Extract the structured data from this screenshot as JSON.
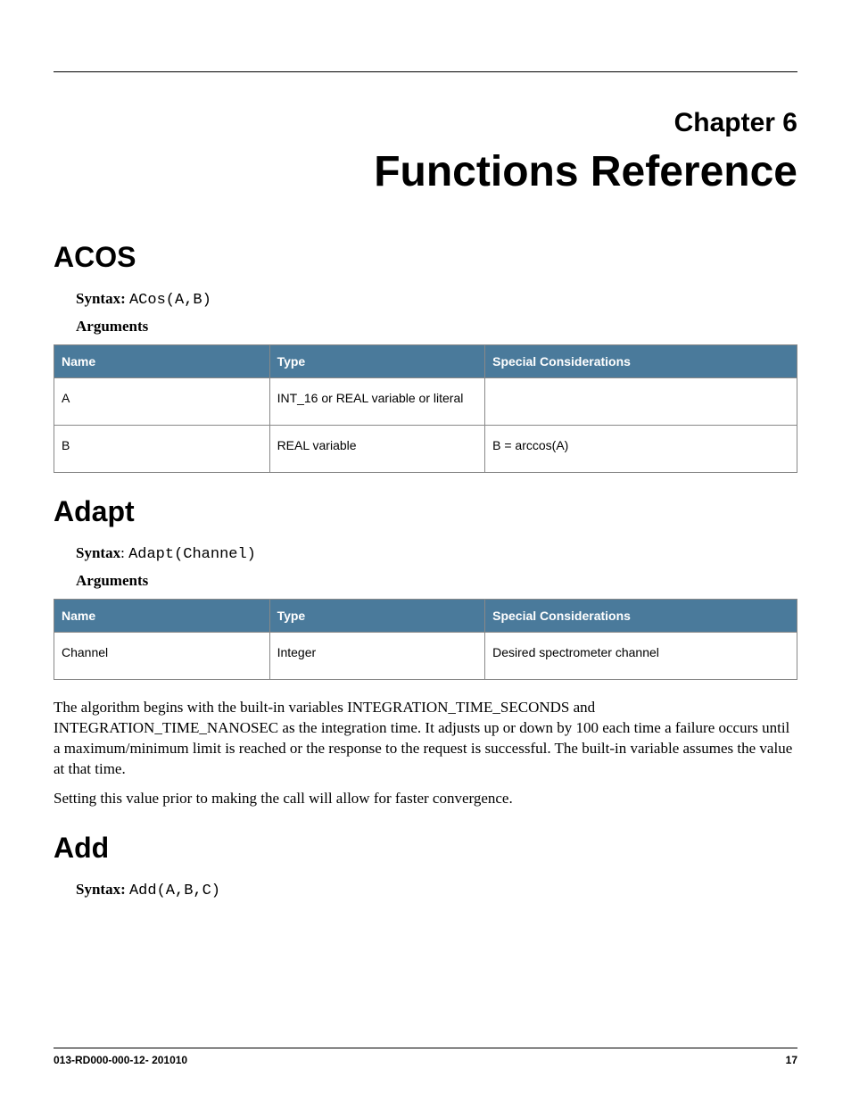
{
  "chapter": {
    "label": "Chapter 6",
    "title": "Functions Reference"
  },
  "sections": {
    "acos": {
      "heading": "ACOS",
      "syntax_label": "Syntax: ",
      "syntax_code": "ACos(A,B)",
      "arguments_label": "Arguments",
      "table": {
        "headers": [
          "Name",
          "Type",
          "Special Considerations"
        ],
        "rows": [
          {
            "name": "A",
            "type": "INT_16 or REAL variable or literal",
            "special": ""
          },
          {
            "name": "B",
            "type": "REAL variable",
            "special": "B = arccos(A)"
          }
        ]
      }
    },
    "adapt": {
      "heading": "Adapt",
      "syntax_label": "Syntax",
      "syntax_colon": ": ",
      "syntax_code": "Adapt(Channel)",
      "arguments_label": "Arguments",
      "table": {
        "headers": [
          "Name",
          "Type",
          "Special Considerations"
        ],
        "rows": [
          {
            "name": "Channel",
            "type": "Integer",
            "special": "Desired spectrometer channel"
          }
        ]
      },
      "para1": "The algorithm begins with the built-in variables INTEGRATION_TIME_SECONDS and INTEGRATION_TIME_NANOSEC as the integration time. It adjusts up or down by 100 each time a failure occurs until a maximum/minimum limit is reached or the response to the request is successful. The built-in variable assumes the value at that time.",
      "para2": "Setting this value prior to making the call will allow for faster convergence."
    },
    "add": {
      "heading": "Add",
      "syntax_label": "Syntax: ",
      "syntax_code": "Add(A,B,C)"
    }
  },
  "footer": {
    "left": "013-RD000-000-12- 201010",
    "right": "17"
  }
}
